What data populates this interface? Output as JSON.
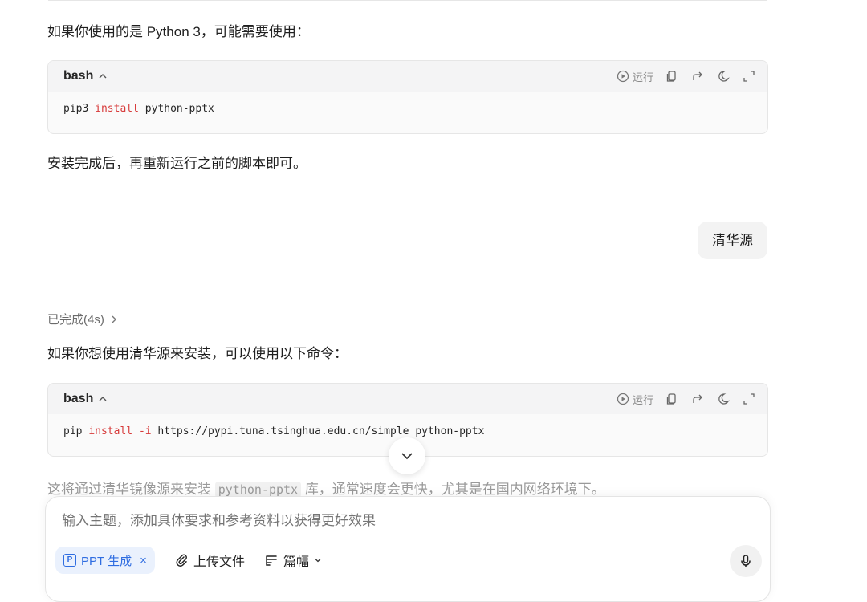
{
  "messages": {
    "intro_python3": "如果你使用的是 Python 3，可能需要使用：",
    "after_install": "安装完成后，再重新运行之前的脚本即可。",
    "user_bubble": "清华源",
    "status": "已完成(4s)",
    "intro_tsinghua": "如果你想使用清华源来安装，可以使用以下命令：",
    "faded_prefix": "这将通过清华镜像源来安装",
    "faded_code": "python-pptx",
    "faded_suffix": "库，通常速度会更快，尤其是在国内网络环境下。"
  },
  "code_blocks": [
    {
      "lang": "bash",
      "run_label": "运行",
      "cmd": "pip3",
      "keyword": "install",
      "rest": " python-pptx"
    },
    {
      "lang": "bash",
      "run_label": "运行",
      "cmd": "pip",
      "keyword": "install",
      "flag": "-i",
      "rest": " https://pypi.tuna.tsinghua.edu.cn/simple python-pptx"
    }
  ],
  "composer": {
    "placeholder": "输入主题，添加具体要求和参考资料以获得更好效果",
    "chip_label": "PPT 生成",
    "chip_icon_letter": "P",
    "chip_close": "×",
    "upload_label": "上传文件",
    "length_label": "篇幅"
  },
  "colors": {
    "keyword": "#d73a3a",
    "accent": "#2f6de1",
    "chip_bg": "#eaf1fd"
  },
  "icons": [
    "chevron-up-icon",
    "play-circle-icon",
    "copy-icon",
    "share-icon",
    "theme-icon",
    "expand-icon",
    "chevron-right-icon",
    "chevron-down-icon",
    "paperclip-icon",
    "list-icon",
    "microphone-icon"
  ]
}
